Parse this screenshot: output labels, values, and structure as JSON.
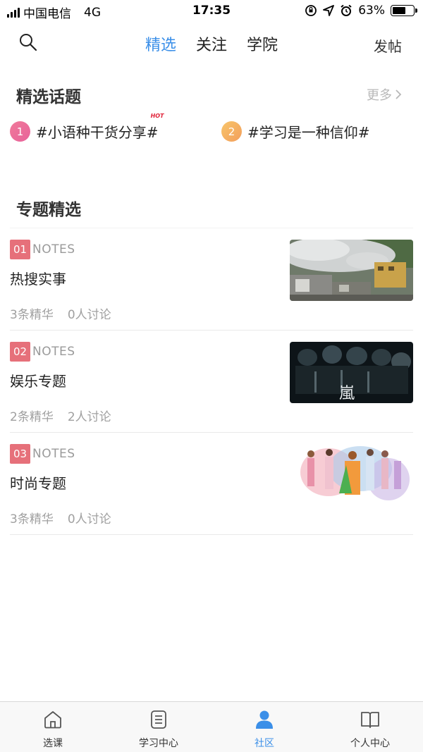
{
  "status_bar": {
    "carrier": "中国电信",
    "network": "4G",
    "time": "17:35",
    "battery": "63%",
    "battery_level": 0.63
  },
  "nav": {
    "tabs": [
      {
        "label": "精选",
        "active": true
      },
      {
        "label": "关注",
        "active": false
      },
      {
        "label": "学院",
        "active": false
      }
    ],
    "post_label": "发帖"
  },
  "featured_topics": {
    "title": "精选话题",
    "more_label": "更多",
    "items": [
      {
        "num": "1",
        "text": "#小语种干货分享#",
        "badge": "HOT"
      },
      {
        "num": "2",
        "text": "#学习是一种信仰#"
      }
    ]
  },
  "special_topics": {
    "title": "专题精选",
    "items": [
      {
        "num": "01",
        "tag": "NOTES",
        "title": "热搜实事",
        "essence": "3条精华",
        "discussion": "0人讨论",
        "image": "smoke-over-buildings-photo"
      },
      {
        "num": "02",
        "tag": "NOTES",
        "title": "娱乐专题",
        "essence": "2条精华",
        "discussion": "2人讨论",
        "image": "band-group-photo",
        "image_text": "嵐"
      },
      {
        "num": "03",
        "tag": "NOTES",
        "title": "时尚专题",
        "essence": "3条精华",
        "discussion": "0人讨论",
        "image": "fashion-illustration"
      }
    ]
  },
  "tab_bar": {
    "items": [
      {
        "label": "选课",
        "icon": "home-icon",
        "active": false
      },
      {
        "label": "学习中心",
        "icon": "document-icon",
        "active": false
      },
      {
        "label": "社区",
        "icon": "person-icon",
        "active": true
      },
      {
        "label": "个人中心",
        "icon": "book-icon",
        "active": false
      }
    ]
  },
  "colors": {
    "accent": "#3b8fe8",
    "tag_red": "#e6707a",
    "muted": "#a0a0a0"
  }
}
